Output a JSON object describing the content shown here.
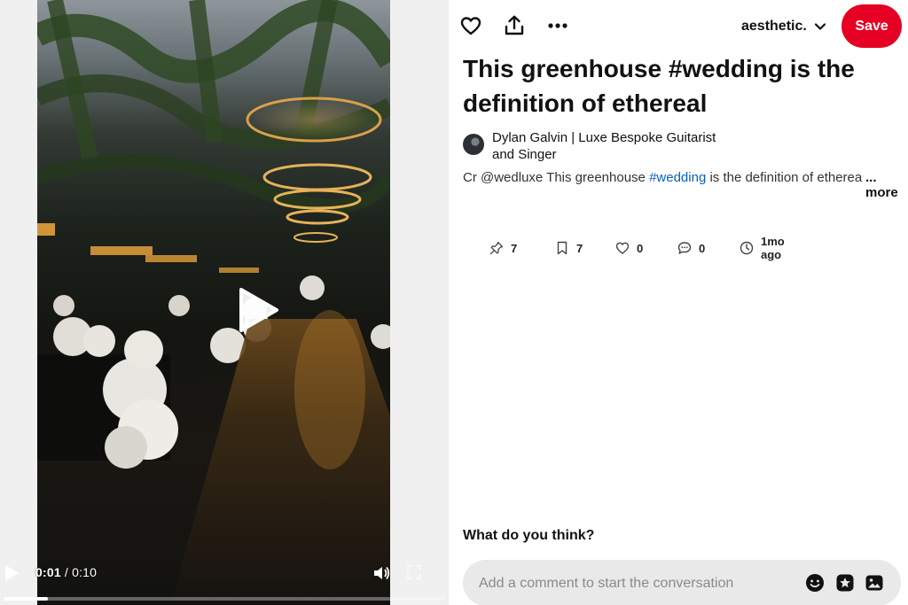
{
  "video": {
    "current_time": "0:01",
    "separator": "/",
    "duration": "0:10",
    "progress_fraction": 0.1
  },
  "toolbar": {
    "icons": [
      "heart-icon",
      "share-icon",
      "more-options-icon"
    ],
    "board_name": "aesthetic.",
    "save_label": "Save"
  },
  "pin": {
    "title": "This greenhouse #wedding is the definition of ethereal",
    "creator": "Dylan Galvin | Luxe Bespoke Guitarist and Singer",
    "description": {
      "prefix": "Cr @wedluxe This greenhouse ",
      "hashtag": "#wedding",
      "suffix": " is the definition of ethereal",
      "faded": " | #",
      "more_label": "... more"
    }
  },
  "stats": [
    {
      "icon": "pin-icon",
      "value": "7"
    },
    {
      "icon": "bookmark-icon",
      "value": "7"
    },
    {
      "icon": "heart-outline-icon",
      "value": "0"
    },
    {
      "icon": "comment-bubble-icon",
      "value": "0"
    },
    {
      "icon": "clock-icon",
      "value": "1mo ago"
    }
  ],
  "comments": {
    "heading": "What do you think?",
    "placeholder": "Add a comment to start the conversation",
    "icons": [
      "emoji-icon",
      "sticker-icon",
      "image-icon"
    ]
  },
  "colors": {
    "save_button": "#e60023",
    "hashtag_link": "#0a5fbf",
    "comment_bar": "#e9e9e9"
  }
}
